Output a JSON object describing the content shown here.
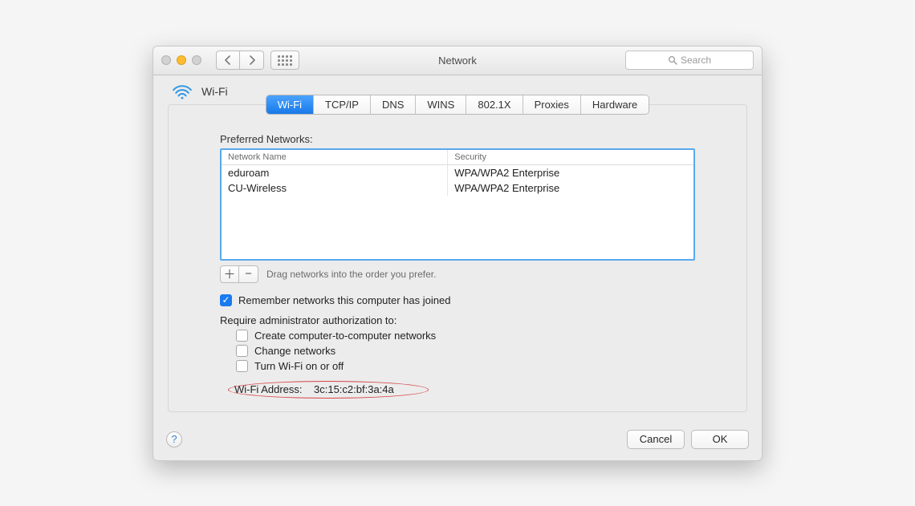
{
  "window": {
    "title": "Network",
    "search_placeholder": "Search"
  },
  "service": {
    "name": "Wi-Fi"
  },
  "tabs": [
    "Wi-Fi",
    "TCP/IP",
    "DNS",
    "WINS",
    "802.1X",
    "Proxies",
    "Hardware"
  ],
  "preferred": {
    "label": "Preferred Networks:",
    "columns": {
      "name": "Network Name",
      "security": "Security"
    },
    "rows": [
      {
        "name": "eduroam",
        "security": "WPA/WPA2 Enterprise"
      },
      {
        "name": "CU-Wireless",
        "security": "WPA/WPA2 Enterprise"
      }
    ],
    "hint": "Drag networks into the order you prefer."
  },
  "remember_label": "Remember networks this computer has joined",
  "admin_label": "Require administrator authorization to:",
  "admin_opts": {
    "create": "Create computer-to-computer networks",
    "change": "Change networks",
    "toggle": "Turn Wi-Fi on or off"
  },
  "address": {
    "label": "Wi-Fi Address:",
    "value": "3c:15:c2:bf:3a:4a"
  },
  "buttons": {
    "cancel": "Cancel",
    "ok": "OK"
  }
}
